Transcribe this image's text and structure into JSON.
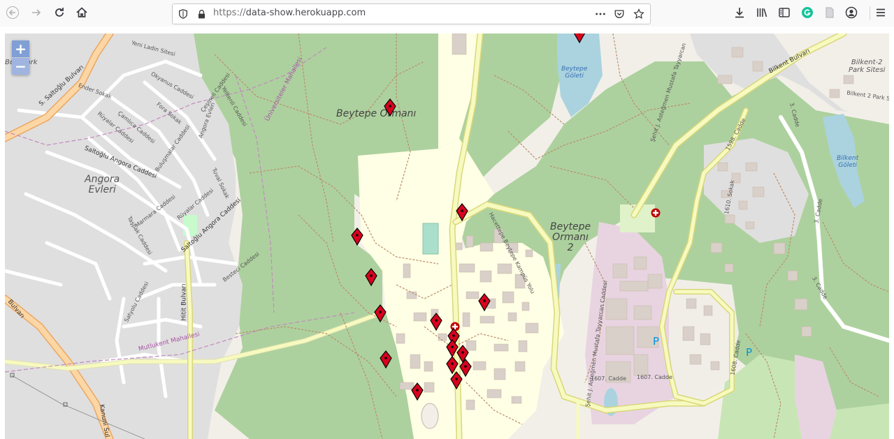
{
  "browser": {
    "url_scheme": "https://",
    "url_host": "data-show.herokuapp.com",
    "nav_icons": [
      "back-icon",
      "forward-icon",
      "reload-icon",
      "home-icon"
    ],
    "toolbar_icons": [
      "download-icon",
      "library-icon",
      "sidebar-icon",
      "grammarly-icon",
      "reader-icon",
      "account-icon",
      "menu-icon"
    ]
  },
  "map": {
    "zoom_in_label": "+",
    "zoom_out_label": "−",
    "places": {
      "beytepe_ormani": "Beytepe Ormanı",
      "beytepe_ormani_2_line1": "Beytepe",
      "beytepe_ormani_2_line2": "Ormanı",
      "beytepe_ormani_2_line3": "2",
      "angora_evleri_line1": "Angora",
      "angora_evleri_line2": "Evleri",
      "beytepe_goleti_line1": "Beytepe",
      "beytepe_goleti_line2": "Göleti",
      "bilkent_goleti_line1": "Bilkent",
      "bilkent_goleti_line2": "Göleti",
      "bilkent2_park_line1": "Bilkent-2",
      "bilkent2_park_line2": "Park Sitesi",
      "bilkent2_park_street": "Bilkent 2 Park Sit",
      "beyzpark": "Beyzpark",
      "yeni_ladin": "Yeni Ladin Sitesi",
      "universiteler": "Üniversiteler Mahallesi",
      "mutlukent": "Mutlukent Mahallesi"
    },
    "streets": {
      "saltoglu_bulvari": "S. Saltoğlu Bulvarı",
      "bilkent_bulvari": "Bilkent Bulvarı",
      "ender": "Ender Sokak",
      "okyanus": "Okyanus Caddesi",
      "cesmeli": "Çeşmeli Caddesi",
      "yelkenli": "Yelkenli Caddesi",
      "fora": "Fora Sokak",
      "angora_evleri": "Angora Evleri",
      "ruyalar": "Rüyalar Caddesi",
      "camlica": "Çamlıca Caddesi",
      "saltoglu_angora": "Saltoğlu Angora Caddesi",
      "bulusmalar": "Buluşmalar Caddesi",
      "tuval": "Tuval Sokak",
      "ruyalar2": "Rüyalar Caddesi",
      "marmara": "Marmara Caddesi",
      "tasplak": "Taşpak Caddesi",
      "saltoglu_angora2": "Saltoğlu Angora Caddesi",
      "besteci": "Besteci Caddesi",
      "satyollu": "Satyolu Caddesi",
      "hitit": "Hitit Bulvarı",
      "kanuni": "Kanuni Sul",
      "bulvari": "Bulvarı",
      "hacettepe": "Hacettepe Beytepe Kampüs Yolu",
      "sehit1": "Şehit J. Asteğmen Mustafa Tayyarcan",
      "sehit2": "Şehit J. Asteğmen Mustafa Tayyarcan Caddesi",
      "c1598": "1598. Cadde",
      "s1610": "1610. Sokak",
      "c3a": "3. Cadde",
      "c3b": "3. Cadde",
      "c3c": "3. Cadde",
      "c1608": "1608. Cadde",
      "c1607a": "1607. Cadde",
      "c1607b": "1607. Cadde"
    },
    "parking_label_1": "P",
    "parking_label_2": "P",
    "marker_count": 17,
    "colors": {
      "forest": "#add19e",
      "university": "#ffffe5",
      "water": "#aad3df",
      "residential": "#e0dfdf",
      "hospital": "#e8d4e1",
      "motorway": "#fcd6a4",
      "primary": "#f7fabf",
      "marker": "#d9001e"
    }
  }
}
